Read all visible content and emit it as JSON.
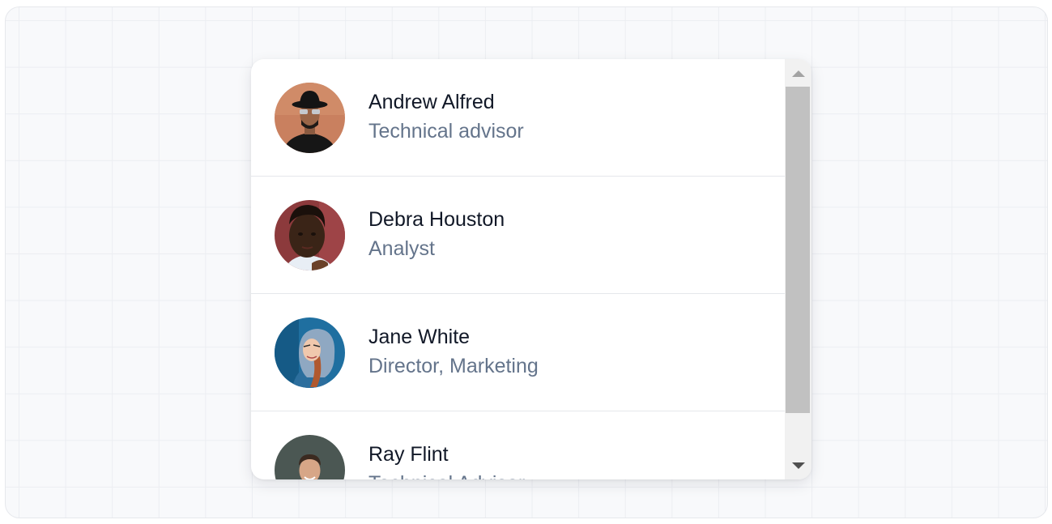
{
  "people": [
    {
      "name": "Andrew Alfred",
      "role": "Technical advisor"
    },
    {
      "name": "Debra Houston",
      "role": "Analyst"
    },
    {
      "name": "Jane White",
      "role": "Director, Marketing"
    },
    {
      "name": "Ray Flint",
      "role": "Technical Advisor"
    }
  ],
  "colors": {
    "name_text": "#111827",
    "role_text": "#64748b",
    "divider": "#e5e7eb",
    "scrollbar_track": "#f1f1f1",
    "scrollbar_thumb": "#c1c1c1"
  },
  "icons": {
    "scroll_up": "triangle-up-icon",
    "scroll_down": "triangle-down-icon"
  }
}
